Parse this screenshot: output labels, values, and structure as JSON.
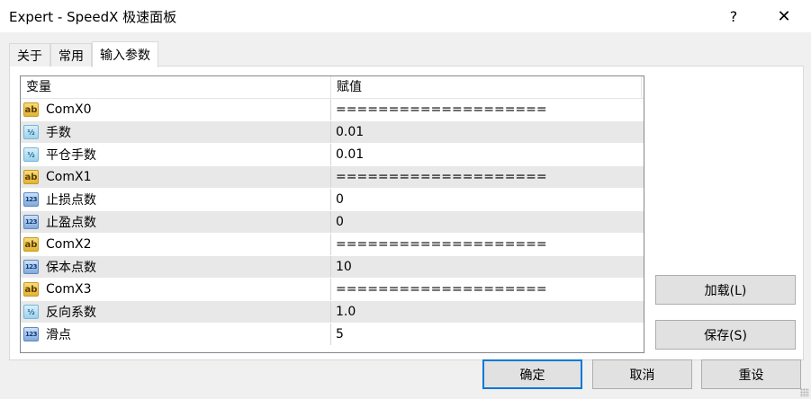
{
  "window": {
    "title": "Expert - SpeedX 极速面板",
    "help_label": "?",
    "close_label": "✕"
  },
  "tabs": [
    {
      "label": "关于"
    },
    {
      "label": "常用"
    },
    {
      "label": "输入参数"
    }
  ],
  "active_tab": "输入参数",
  "grid": {
    "columns": [
      "变量",
      "赋值"
    ],
    "rows": [
      {
        "icon": "ab",
        "icon_text": "ab",
        "name": "ComX0",
        "value": "===================="
      },
      {
        "icon": "half",
        "icon_text": "½",
        "name": "手数",
        "value": "0.01"
      },
      {
        "icon": "half",
        "icon_text": "½",
        "name": "平仓手数",
        "value": "0.01"
      },
      {
        "icon": "ab",
        "icon_text": "ab",
        "name": "ComX1",
        "value": "===================="
      },
      {
        "icon": "num",
        "icon_text": "123",
        "name": "止损点数",
        "value": "0"
      },
      {
        "icon": "num",
        "icon_text": "123",
        "name": "止盈点数",
        "value": "0"
      },
      {
        "icon": "ab",
        "icon_text": "ab",
        "name": "ComX2",
        "value": "===================="
      },
      {
        "icon": "num",
        "icon_text": "123",
        "name": "保本点数",
        "value": "10"
      },
      {
        "icon": "ab",
        "icon_text": "ab",
        "name": "ComX3",
        "value": "===================="
      },
      {
        "icon": "half",
        "icon_text": "½",
        "name": "反向系数",
        "value": "1.0"
      },
      {
        "icon": "num",
        "icon_text": "123",
        "name": "滑点",
        "value": "5"
      }
    ]
  },
  "side_buttons": {
    "load_label": "加载(L)",
    "save_label": "保存(S)"
  },
  "footer_buttons": {
    "ok_label": "确定",
    "cancel_label": "取消",
    "reset_label": "重设"
  }
}
